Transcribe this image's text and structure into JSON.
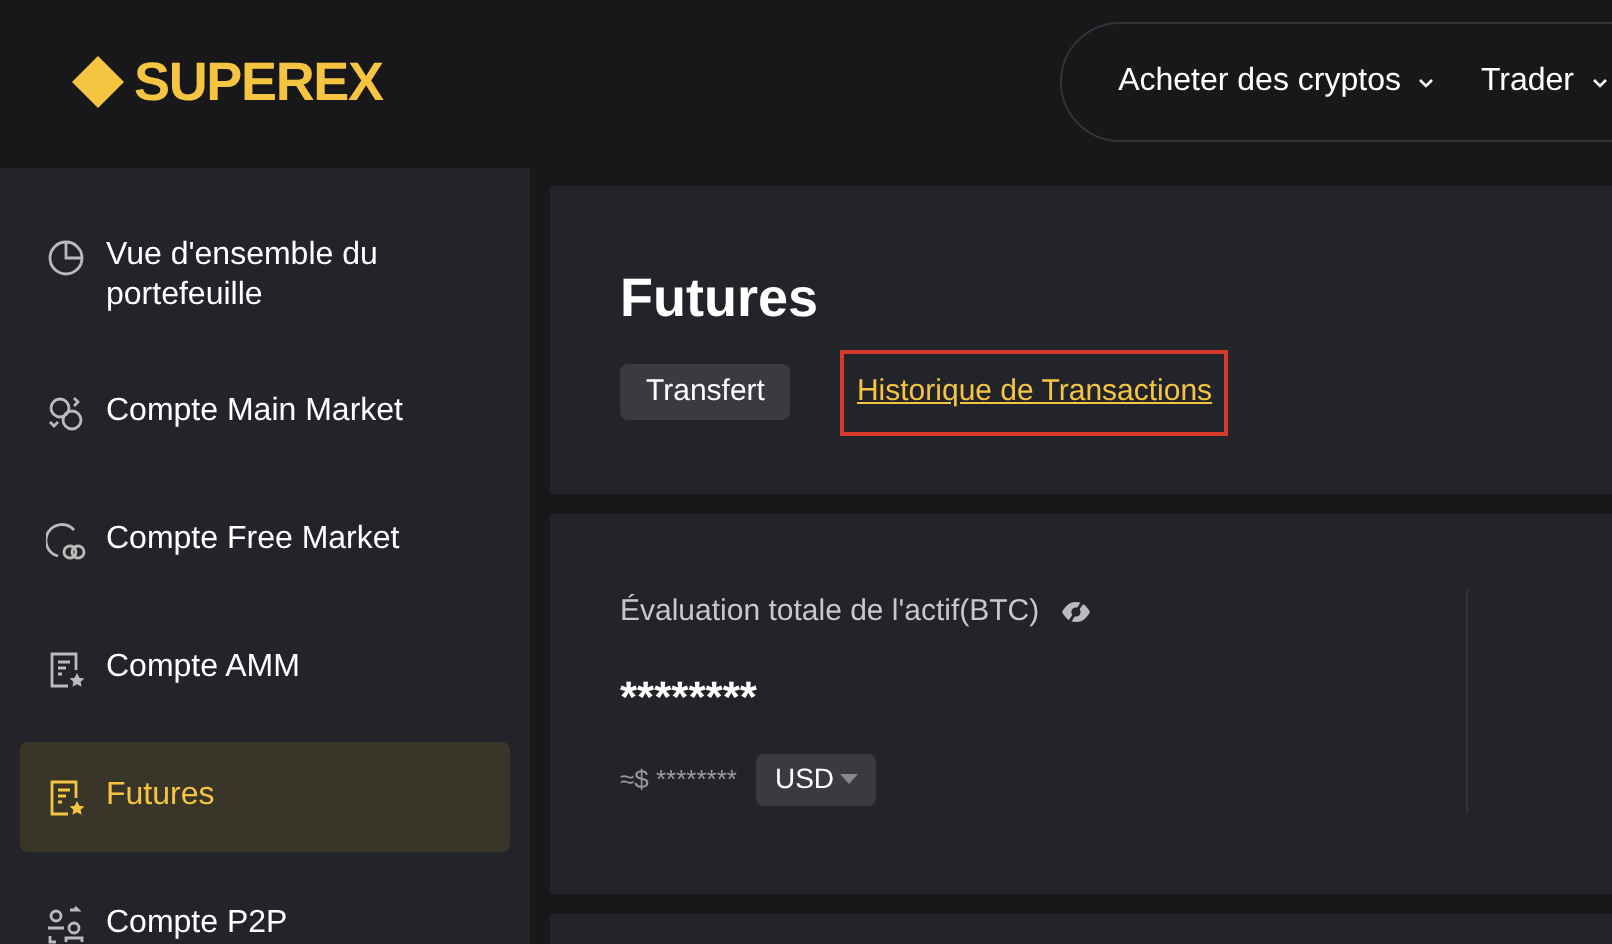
{
  "header": {
    "logo": "SUPEREX",
    "nav": [
      {
        "label": "Acheter des cryptos"
      },
      {
        "label": "Trader"
      }
    ]
  },
  "sidebar": {
    "items": [
      {
        "label": "Vue d'ensemble du portefeuille",
        "selected": false
      },
      {
        "label": "Compte Main Market",
        "selected": false
      },
      {
        "label": "Compte Free Market",
        "selected": false
      },
      {
        "label": "Compte AMM",
        "selected": false
      },
      {
        "label": "Futures",
        "selected": true
      },
      {
        "label": "Compte P2P",
        "selected": false
      }
    ]
  },
  "page": {
    "title": "Futures",
    "transfer_button": "Transfert",
    "history_link": {
      "label": "Historique de Transactions",
      "highlighted": true
    }
  },
  "valuation": {
    "label": "Évaluation totale de l'actif(BTC)",
    "value": "********",
    "approx": "≈$ ********",
    "currency": "USD"
  }
}
